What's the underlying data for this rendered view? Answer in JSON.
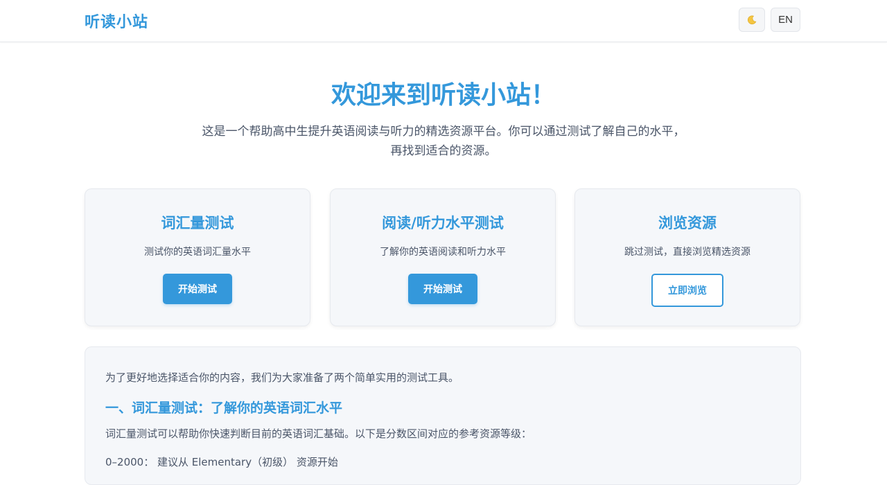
{
  "header": {
    "logo": "听读小站",
    "theme_icon": "moon-icon",
    "lang_label": "EN"
  },
  "hero": {
    "title": "欢迎来到听读小站！",
    "description_line1": "这是一个帮助高中生提升英语阅读与听力的精选资源平台。你可以通过测试了解自己的水平，",
    "description_line2": "再找到适合的资源。"
  },
  "cards": [
    {
      "title": "词汇量测试",
      "description": "测试你的英语词汇量水平",
      "button": "开始测试"
    },
    {
      "title": "阅读/听力水平测试",
      "description": "了解你的英语阅读和听力水平",
      "button": "开始测试"
    },
    {
      "title": "浏览资源",
      "description": "跳过测试，直接浏览精选资源",
      "button": "立即浏览"
    }
  ],
  "info": {
    "intro": "为了更好地选择适合你的内容，我们为大家准备了两个简单实用的测试工具。",
    "heading": "一、词汇量测试：了解你的英语词汇水平",
    "text": "词汇量测试可以帮助你快速判断目前的英语词汇基础。以下是分数区间对应的参考资源等级：",
    "range_1": "0–2000： 建议从 Elementary（初级） 资源开始"
  },
  "colors": {
    "accent": "#3498db",
    "card_bg": "#f5f7fa",
    "text": "#4a5568"
  }
}
